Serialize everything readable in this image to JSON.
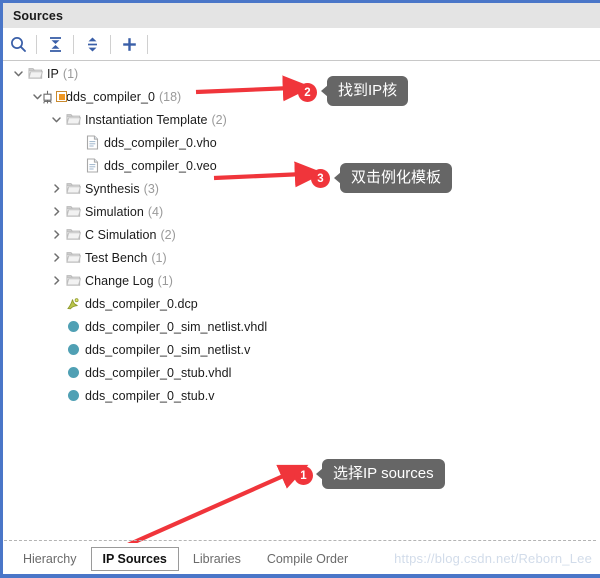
{
  "window": {
    "title": "Sources"
  },
  "toolbar": {
    "items": [
      {
        "name": "search-icon",
        "tooltip": "Search"
      },
      {
        "name": "collapse-all-icon",
        "tooltip": "Collapse All"
      },
      {
        "name": "expand-all-icon",
        "tooltip": "Expand All"
      },
      {
        "name": "add-sources-icon",
        "tooltip": "Add Sources"
      }
    ]
  },
  "tree": {
    "rows": [
      {
        "indent": 0,
        "twisty": "down",
        "icon": "folder-icon",
        "label": "IP",
        "count": "(1)"
      },
      {
        "indent": 1,
        "twisty": "down",
        "icon": "ip-core-icon",
        "label": "dds_compiler_0",
        "count": "(18)"
      },
      {
        "indent": 2,
        "twisty": "down",
        "icon": "folder-icon",
        "label": "Instantiation Template",
        "count": "(2)"
      },
      {
        "indent": 3,
        "twisty": "none",
        "icon": "document-icon",
        "label": "dds_compiler_0.vho",
        "count": ""
      },
      {
        "indent": 3,
        "twisty": "none",
        "icon": "document-icon",
        "label": "dds_compiler_0.veo",
        "count": ""
      },
      {
        "indent": 2,
        "twisty": "right",
        "icon": "folder-icon",
        "label": "Synthesis",
        "count": "(3)"
      },
      {
        "indent": 2,
        "twisty": "right",
        "icon": "folder-icon",
        "label": "Simulation",
        "count": "(4)"
      },
      {
        "indent": 2,
        "twisty": "right",
        "icon": "folder-icon",
        "label": "C Simulation",
        "count": "(2)"
      },
      {
        "indent": 2,
        "twisty": "right",
        "icon": "folder-icon",
        "label": "Test Bench",
        "count": "(1)"
      },
      {
        "indent": 2,
        "twisty": "right",
        "icon": "folder-icon",
        "label": "Change Log",
        "count": "(1)"
      },
      {
        "indent": 2,
        "twisty": "none",
        "icon": "dcp-icon",
        "label": "dds_compiler_0.dcp",
        "count": ""
      },
      {
        "indent": 2,
        "twisty": "none",
        "icon": "circle-icon",
        "label": "dds_compiler_0_sim_netlist.vhdl",
        "count": ""
      },
      {
        "indent": 2,
        "twisty": "none",
        "icon": "circle-icon",
        "label": "dds_compiler_0_sim_netlist.v",
        "count": ""
      },
      {
        "indent": 2,
        "twisty": "none",
        "icon": "circle-icon",
        "label": "dds_compiler_0_stub.vhdl",
        "count": ""
      },
      {
        "indent": 2,
        "twisty": "none",
        "icon": "circle-icon",
        "label": "dds_compiler_0_stub.v",
        "count": ""
      }
    ]
  },
  "annotations": [
    {
      "number": "1",
      "text": "选择IP sources"
    },
    {
      "number": "2",
      "text": "找到IP核"
    },
    {
      "number": "3",
      "text": "双击例化模板"
    }
  ],
  "tabs": [
    {
      "label": "Hierarchy",
      "active": false
    },
    {
      "label": "IP Sources",
      "active": true
    },
    {
      "label": "Libraries",
      "active": false
    },
    {
      "label": "Compile Order",
      "active": false
    }
  ],
  "watermark": "https://blog.csdn.net/Reborn_Lee",
  "colors": {
    "frame": "#4a76c8",
    "titlebar": "#e4e4e4",
    "toolbar_icon": "#3a5fa8",
    "annotation_red": "#f0353b",
    "annotation_bubble": "#666666",
    "file_circle": "#50a0b4",
    "ip_square": "#f0961e"
  }
}
